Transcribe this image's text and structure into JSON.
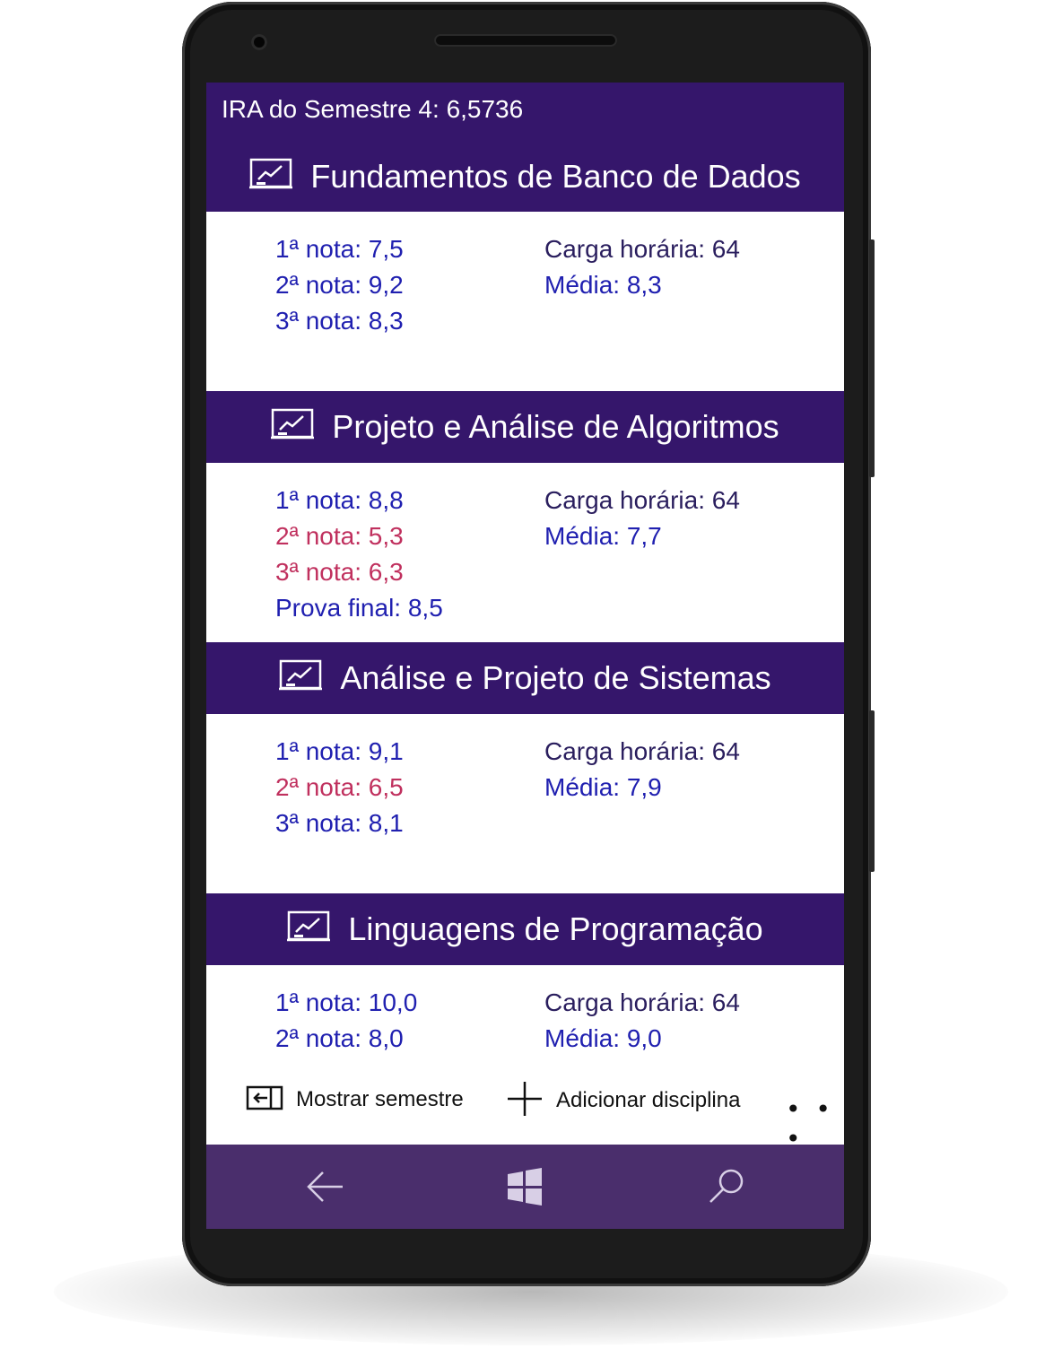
{
  "header": {
    "ira_label": "IRA do Semestre 4: 6,5736"
  },
  "courses": [
    {
      "title": "Fundamentos de Banco de Dados",
      "grades": [
        {
          "text": "1ª nota: 7,5",
          "status": "ok"
        },
        {
          "text": "2ª nota: 9,2",
          "status": "ok"
        },
        {
          "text": "3ª nota: 8,3",
          "status": "ok"
        }
      ],
      "workload": "Carga horária:  64",
      "average": "Média: 8,3"
    },
    {
      "title": "Projeto e Análise de Algoritmos",
      "grades": [
        {
          "text": "1ª nota: 8,8",
          "status": "ok"
        },
        {
          "text": "2ª nota: 5,3",
          "status": "low"
        },
        {
          "text": "3ª nota: 6,3",
          "status": "low"
        },
        {
          "text": "Prova final: 8,5",
          "status": "ok"
        }
      ],
      "workload": "Carga horária:  64",
      "average": "Média: 7,7"
    },
    {
      "title": "Análise e Projeto de Sistemas",
      "grades": [
        {
          "text": "1ª nota: 9,1",
          "status": "ok"
        },
        {
          "text": "2ª nota: 6,5",
          "status": "low"
        },
        {
          "text": "3ª nota: 8,1",
          "status": "ok"
        }
      ],
      "workload": "Carga horária:  64",
      "average": "Média: 7,9"
    },
    {
      "title": "Linguagens de Programação",
      "grades": [
        {
          "text": "1ª nota: 10,0",
          "status": "ok"
        },
        {
          "text": "2ª nota: 8,0",
          "status": "ok"
        }
      ],
      "workload": "Carga horária:  64",
      "average": "Média: 9,0"
    }
  ],
  "appbar": {
    "show_semester_label": "Mostrar semestre",
    "add_course_label": "Adicionar disciplina",
    "more_label": "• • •"
  },
  "navbar": {
    "icons": [
      "back-arrow-icon",
      "windows-logo-icon",
      "search-icon"
    ]
  },
  "colors": {
    "header_bg": "#35166b",
    "navbar_bg": "#4a2e6c",
    "grade_ok": "#2020b0",
    "grade_low": "#c0305e",
    "info_text": "#2a1e5e"
  }
}
